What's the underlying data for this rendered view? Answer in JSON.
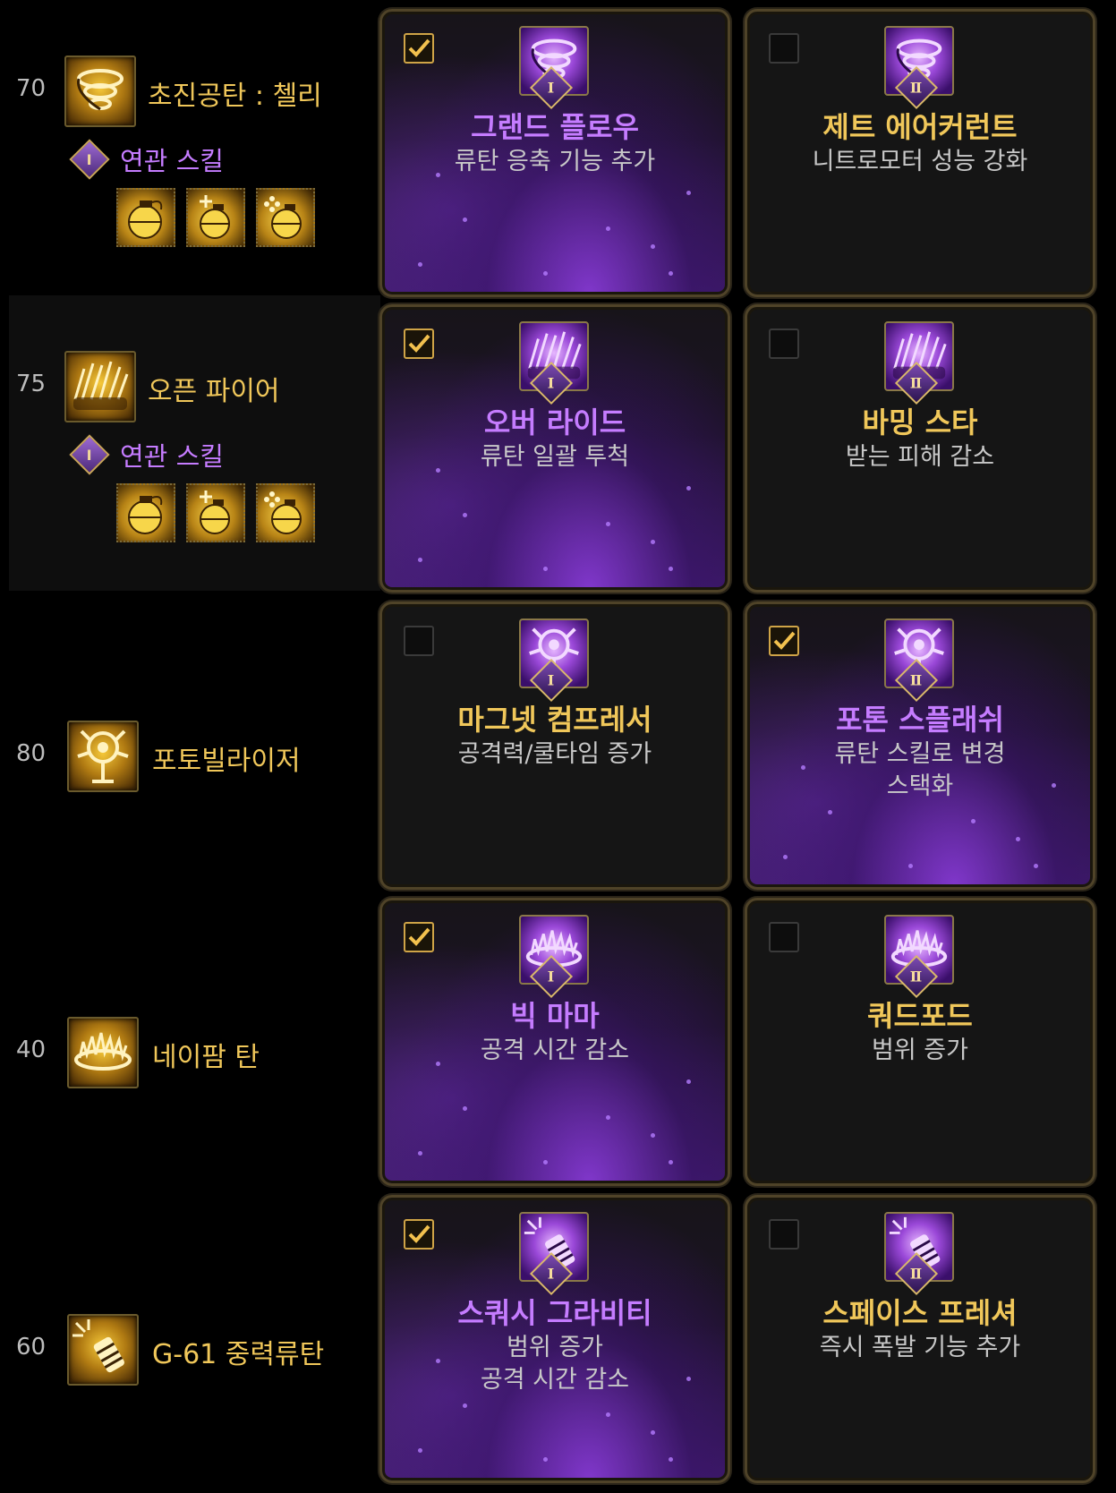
{
  "related_label": "연관 스킬",
  "rows": [
    {
      "level": "70",
      "skill_name": "초진공탄 : 첼리",
      "skill_icon": "vortex-grenade-icon",
      "has_related": true,
      "related_icons": [
        "grenade-icon",
        "flash-grenade-icon",
        "cross-grenade-icon"
      ],
      "options": [
        {
          "rank": "Ⅰ",
          "selected": true,
          "title": "그랜드 플로우",
          "desc": [
            "류탄 응축 기능 추가"
          ],
          "icon": "vortex-icon"
        },
        {
          "rank": "Ⅱ",
          "selected": false,
          "title": "제트 에어커런트",
          "desc": [
            "니트로모터 성능 강화"
          ],
          "icon": "vortex-icon"
        }
      ]
    },
    {
      "level": "75",
      "skill_name": "오픈 파이어",
      "skill_icon": "gunfire-icon",
      "has_related": true,
      "related_icons": [
        "grenade-icon",
        "flash-grenade-icon",
        "cross-grenade-icon"
      ],
      "options": [
        {
          "rank": "Ⅰ",
          "selected": true,
          "title": "오버 라이드",
          "desc": [
            "류탄 일괄 투척"
          ],
          "icon": "spread-fire-icon"
        },
        {
          "rank": "Ⅱ",
          "selected": false,
          "title": "바밍 스타",
          "desc": [
            "받는 피해 감소"
          ],
          "icon": "spread-fire-icon"
        }
      ]
    },
    {
      "level": "80",
      "skill_name": "포토빌라이저",
      "skill_icon": "photon-tree-icon",
      "has_related": false,
      "related_icons": [],
      "options": [
        {
          "rank": "Ⅰ",
          "selected": false,
          "title": "마그넷 컴프레서",
          "desc": [
            "공격력/쿨타임 증가"
          ],
          "icon": "photon-burst-icon"
        },
        {
          "rank": "Ⅱ",
          "selected": true,
          "title": "포톤 스플래쉬",
          "desc": [
            "류탄 스킬로 변경",
            "스택화"
          ],
          "icon": "photon-burst-icon"
        }
      ]
    },
    {
      "level": "40",
      "skill_name": "네이팜 탄",
      "skill_icon": "napalm-fire-icon",
      "has_related": false,
      "related_icons": [],
      "options": [
        {
          "rank": "Ⅰ",
          "selected": true,
          "title": "빅 마마",
          "desc": [
            "공격 시간 감소"
          ],
          "icon": "fire-ring-icon"
        },
        {
          "rank": "Ⅱ",
          "selected": false,
          "title": "쿼드포드",
          "desc": [
            "범위 증가"
          ],
          "icon": "fire-ring-icon"
        }
      ]
    },
    {
      "level": "60",
      "skill_name": "G-61 중력류탄",
      "skill_icon": "gravity-grenade-icon",
      "has_related": false,
      "related_icons": [],
      "options": [
        {
          "rank": "Ⅰ",
          "selected": true,
          "title": "스쿼시 그라비티",
          "desc": [
            "범위 증가",
            "공격 시간 감소"
          ],
          "icon": "gravity-canister-icon"
        },
        {
          "rank": "Ⅱ",
          "selected": false,
          "title": "스페이스 프레셔",
          "desc": [
            "즉시 폭발 기능 추가"
          ],
          "icon": "gravity-canister-icon"
        }
      ]
    }
  ]
}
